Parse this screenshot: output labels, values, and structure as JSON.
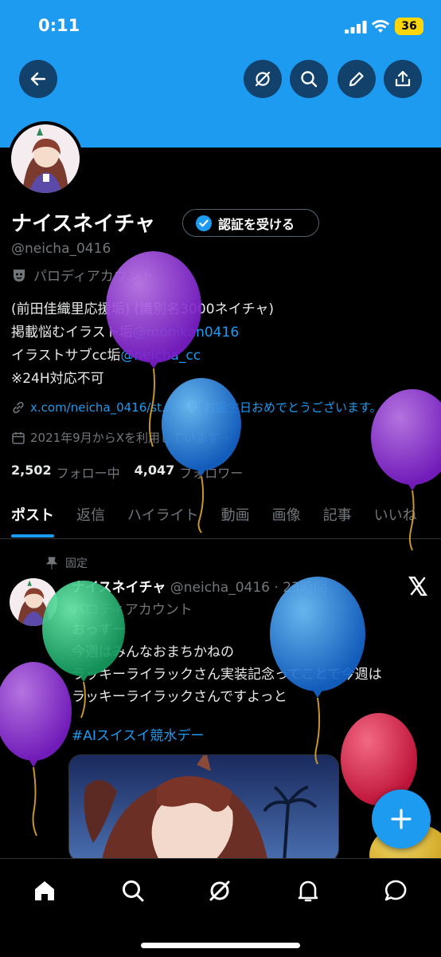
{
  "status_bar": {
    "time": "0:11",
    "battery": "36"
  },
  "header": {
    "icons": [
      "back-arrow-icon",
      "grok-icon",
      "search-icon",
      "edit-pencil-icon",
      "share-icon"
    ],
    "accent": "#1d9bf0"
  },
  "profile": {
    "name": "ナイスネイチャ",
    "verify_label": "認証を受ける",
    "handle": "@neicha_0416",
    "parody_label": "パロディアカウント",
    "bio": {
      "line1": "(前田佳織里応援垢) (識別名3000ネイチャ)",
      "line2_prefix": "掲載悩むイラスト垢",
      "line2_link": "@monikan0416",
      "line3_prefix": "イラストサブcc垢",
      "line3_link": "@neicha_cc",
      "line4": "※24H対応不可"
    },
    "website": "x.com/neicha_0416/st…",
    "birthday_text": "お誕生日おめでとうございます。",
    "joined": "2021年9月からXを利用しています",
    "following_count": "2,502",
    "following_label": "フォロー中",
    "followers_count": "4,047",
    "followers_label": "フォロワー"
  },
  "tabs": [
    {
      "label": "ポスト",
      "active": true
    },
    {
      "label": "返信",
      "active": false
    },
    {
      "label": "ハイライト",
      "active": false
    },
    {
      "label": "動画",
      "active": false
    },
    {
      "label": "画像",
      "active": false
    },
    {
      "label": "記事",
      "active": false
    },
    {
      "label": "いいね",
      "active": false
    }
  ],
  "post": {
    "pinned_label": "固定",
    "author_name": "ナイスネイチャ",
    "author_handle": "@neicha_0416",
    "time": "23時間",
    "parody_label": "パロディアカウント",
    "text_line1": "おっすー",
    "text_line2": "今週はみんなおまちかねの",
    "text_line3": "ラッキーライラックさん実装記念ってことで今週は",
    "text_line4": "ラッキーライラックさんですよっと",
    "hashtag": "#AIスイスイ競水デー"
  },
  "bottom_nav": [
    "home-icon",
    "search-icon",
    "grok-icon",
    "notifications-bell-icon",
    "messages-icon"
  ],
  "fab": {
    "icon": "plus-icon"
  }
}
